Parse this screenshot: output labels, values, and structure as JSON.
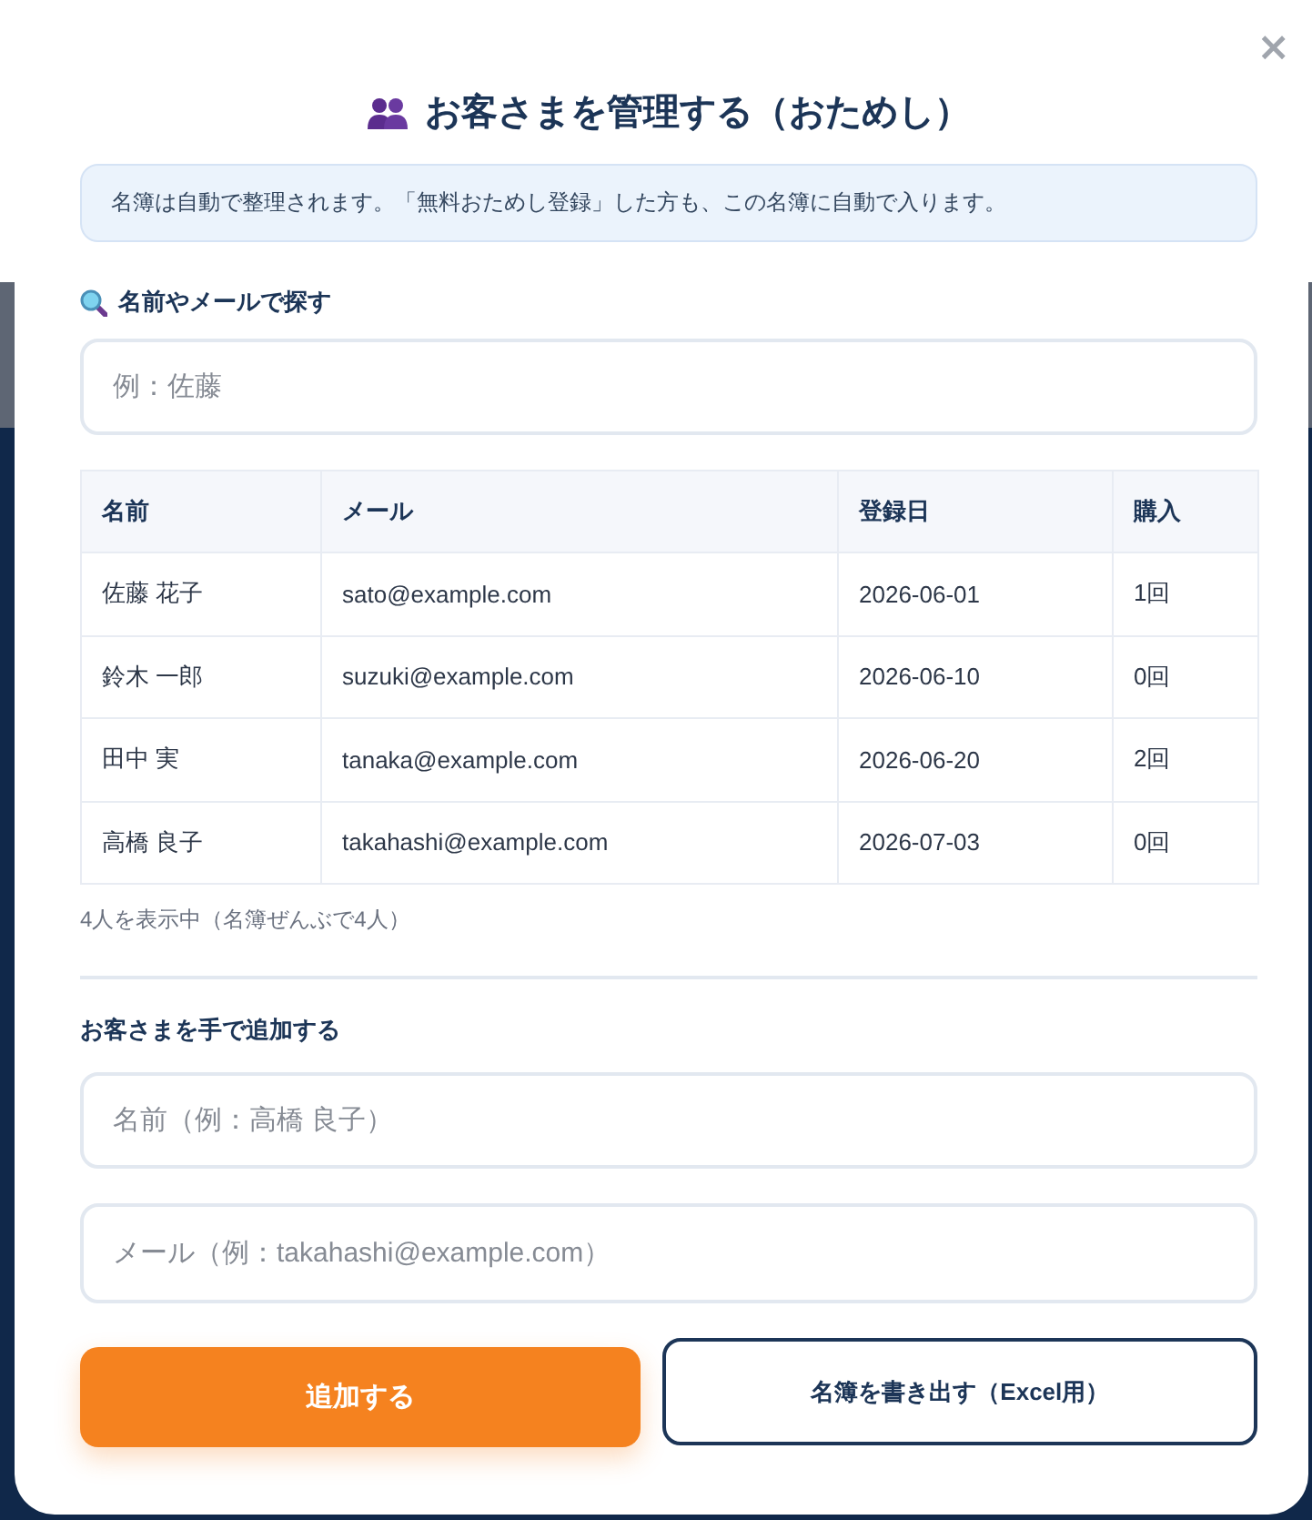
{
  "close_button": {
    "label": "×"
  },
  "title": {
    "text": "お客さまを管理する（おためし）"
  },
  "notice": "名簿は自動で整理されます。「無料おためし登録」した方も、この名簿に自動で入ります。",
  "search": {
    "label": "名前やメールで探す",
    "placeholder": "例：佐藤"
  },
  "table": {
    "columns": [
      "名前",
      "メール",
      "登録日",
      "購入"
    ],
    "rows": [
      [
        "佐藤 花子",
        "sato@example.com",
        "2026-06-01",
        "1回"
      ],
      [
        "鈴木 一郎",
        "suzuki@example.com",
        "2026-06-10",
        "0回"
      ],
      [
        "田中 実",
        "tanaka@example.com",
        "2026-06-20",
        "2回"
      ],
      [
        "高橋 良子",
        "takahashi@example.com",
        "2026-07-03",
        "0回"
      ]
    ]
  },
  "count_text": "4人を表示中（名簿ぜんぶで4人）",
  "add_form": {
    "heading": "お客さまを手で追加する",
    "fields": [
      {
        "placeholder": "名前（例：高橋 良子）"
      },
      {
        "placeholder": "メール（例：takahashi@example.com）"
      }
    ]
  },
  "buttons": [
    {
      "label": "追加する",
      "kind": "primary"
    },
    {
      "label": "名簿を書き出す（Excel用）",
      "kind": "outline"
    }
  ]
}
